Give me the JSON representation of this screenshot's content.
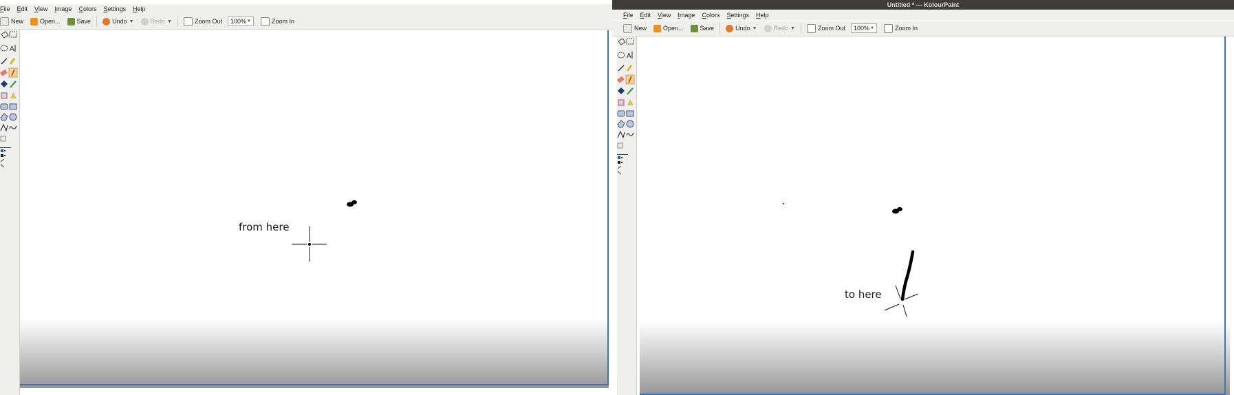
{
  "left": {
    "menu": [
      "File",
      "Edit",
      "View",
      "Image",
      "Colors",
      "Settings",
      "Help"
    ],
    "toolbar": {
      "new": "New",
      "open": "Open...",
      "save": "Save",
      "undo": "Undo",
      "redo": "Redo",
      "zoom_out": "Zoom Out",
      "zoom_value": "100%",
      "zoom_in": "Zoom In"
    },
    "annotation": "from here"
  },
  "right": {
    "title": "Untitled * — KolourPaint",
    "menu": [
      "File",
      "Edit",
      "View",
      "Image",
      "Colors",
      "Settings",
      "Help"
    ],
    "toolbar": {
      "new": "New",
      "open": "Open...",
      "save": "Save",
      "undo": "Undo",
      "redo": "Redo",
      "zoom_out": "Zoom Out",
      "zoom_value": "100%",
      "zoom_in": "Zoom In"
    },
    "annotation": "to here"
  },
  "colors": {
    "accent": "#3e74b5",
    "stroke": "#000000",
    "active_tool": "#f2d49a",
    "dot": "#cc2200"
  },
  "icons": [
    "new-icon",
    "open-icon",
    "save-icon",
    "undo-icon",
    "redo-icon",
    "zoom-out-icon",
    "zoom-in-icon",
    "pencil-icon",
    "brush-icon",
    "eraser-icon",
    "fill-icon",
    "color-picker-icon",
    "rectangle-select-icon",
    "ellipse-select-icon",
    "text-icon",
    "line-icon",
    "polygon-icon",
    "curve-icon"
  ]
}
